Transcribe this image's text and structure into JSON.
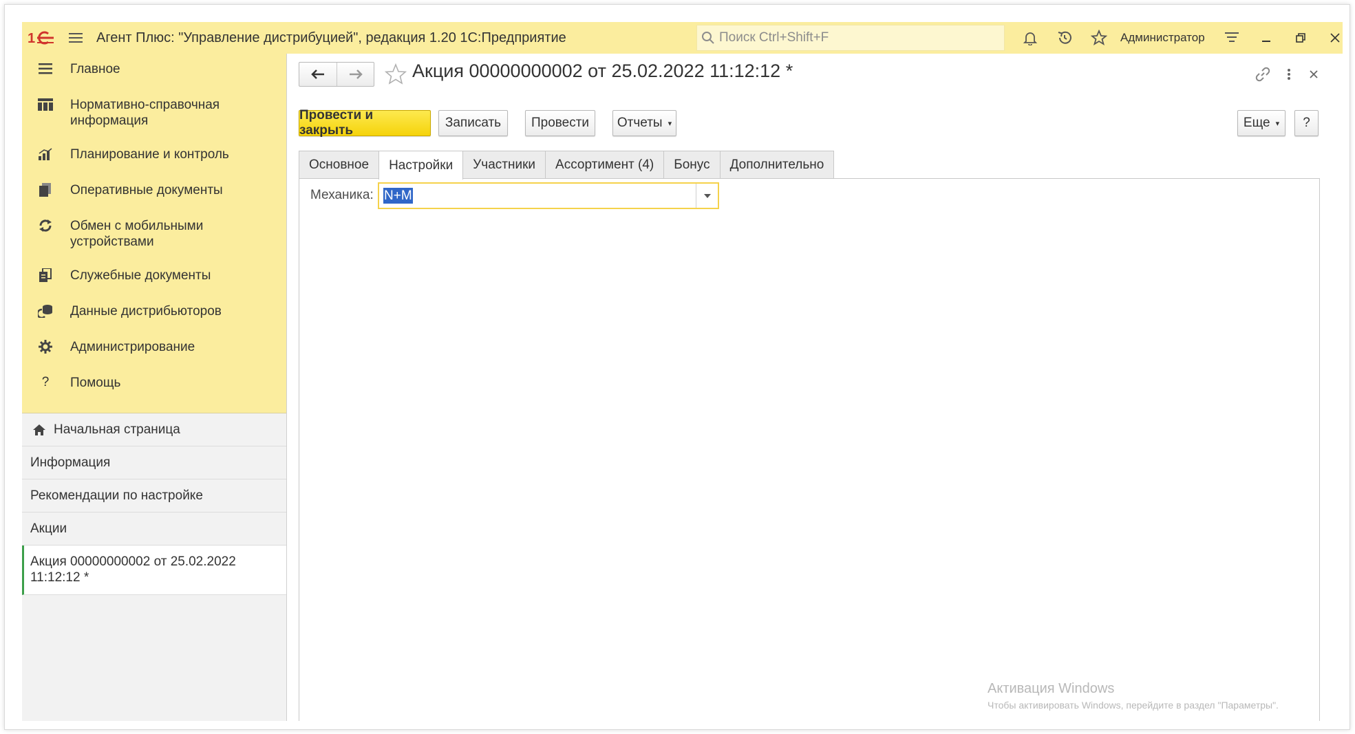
{
  "app": {
    "title": "Агент Плюс: \"Управление дистрибуцией\", редакция 1.20 1С:Предприятие",
    "logo_icon": "1c-logo",
    "search_placeholder": "Поиск Ctrl+Shift+F",
    "user": "Администратор",
    "accent_color": "#fbed9e"
  },
  "sections": [
    {
      "label": "Главное",
      "icon": "menu-icon"
    },
    {
      "label": "Нормативно-справочная информация",
      "icon": "table-icon"
    },
    {
      "label": "Планирование и контроль",
      "icon": "chart-icon"
    },
    {
      "label": "Оперативные документы",
      "icon": "documents-icon"
    },
    {
      "label": "Обмен с мобильными устройствами",
      "icon": "sync-icon"
    },
    {
      "label": "Служебные документы",
      "icon": "service-docs-icon"
    },
    {
      "label": "Данные дистрибьюторов",
      "icon": "distributor-icon"
    },
    {
      "label": "Администрирование",
      "icon": "gear-icon"
    },
    {
      "label": "Помощь",
      "icon": "help-icon"
    }
  ],
  "open_windows": [
    {
      "label": "Начальная страница"
    },
    {
      "label": "Информация"
    },
    {
      "label": "Рекомендации по настройке"
    },
    {
      "label": "Акции"
    },
    {
      "label": "Акция 00000000002 от 25.02.2022 11:12:12 *"
    }
  ],
  "document": {
    "title": "Акция 00000000002 от 25.02.2022 11:12:12 *",
    "buttons": {
      "post_close": "Провести и закрыть",
      "save": "Записать",
      "post": "Провести",
      "reports": "Отчеты",
      "more": "Еще",
      "help": "?"
    },
    "tabs": [
      "Основное",
      "Настройки",
      "Участники",
      "Ассортимент (4)",
      "Бонус",
      "Дополнительно"
    ],
    "active_tab": "Настройки",
    "field": {
      "label": "Механика:",
      "value": "N+M"
    }
  },
  "watermark": {
    "title": "Активация Windows",
    "text": "Чтобы активировать Windows, перейдите в раздел \"Параметры\"."
  }
}
